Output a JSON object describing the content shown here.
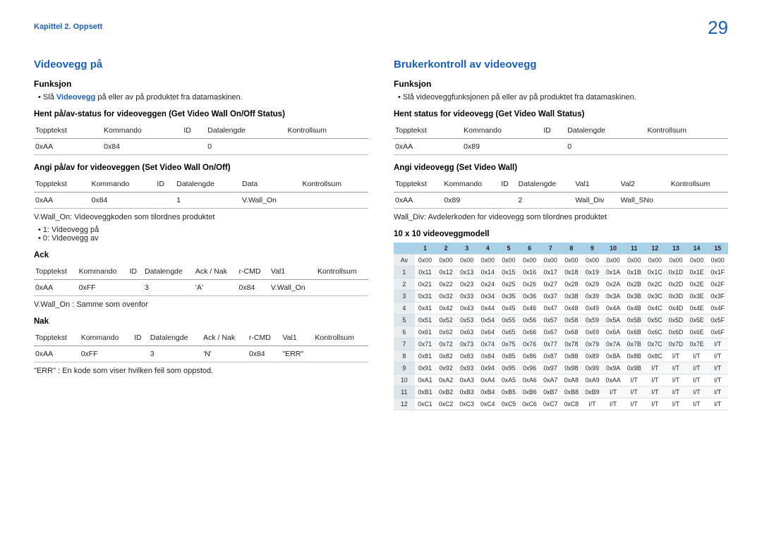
{
  "page": {
    "chapter": "Kapittel 2. Oppsett",
    "number": "29"
  },
  "left": {
    "title": "Videovegg på",
    "funksjon_label": "Funksjon",
    "funksjon_pre": "Slå ",
    "funksjon_accent": "Videovegg",
    "funksjon_post": " på eller av på produktet fra datamaskinen.",
    "get_heading": "Hent på/av-status for videoveggen (Get Video Wall On/Off Status)",
    "set_heading": "Angi på/av for videoveggen (Set Video Wall On/Off)",
    "cols5": {
      "c1": "Topptekst",
      "c2": "Kommando",
      "c3": "ID",
      "c4": "Datalengde",
      "c5": "Kontrollsum"
    },
    "get_row": {
      "c1": "0xAA",
      "c2": "0x84",
      "c3": "",
      "c4": "0",
      "c5": ""
    },
    "set_cols": {
      "c1": "Topptekst",
      "c2": "Kommando",
      "c3": "ID",
      "c4": "Datalengde",
      "c5": "Data",
      "c6": "Kontrollsum"
    },
    "set_row": {
      "c1": "0xAA",
      "c2": "0x84",
      "c3": "",
      "c4": "1",
      "c5": "V.Wall_On",
      "c6": ""
    },
    "explain": "V.Wall_On: Videoveggkoden som tilordnes produktet",
    "opt1": "1: Videovegg på",
    "opt0": "0: Videovegg av",
    "ack_label": "Ack",
    "nak_label": "Nak",
    "ack_cols": {
      "c1": "Topptekst",
      "c2": "Kommando",
      "c3": "ID",
      "c4": "Datalengde",
      "c5": "Ack / Nak",
      "c6": "r-CMD",
      "c7": "Val1",
      "c8": "Kontrollsum"
    },
    "ack_row": {
      "c1": "0xAA",
      "c2": "0xFF",
      "c3": "",
      "c4": "3",
      "c5": "'A'",
      "c6": "0x84",
      "c7": "V.Wall_On",
      "c8": ""
    },
    "ack_note": "V.Wall_On : Samme som ovenfor",
    "nak_row": {
      "c1": "0xAA",
      "c2": "0xFF",
      "c3": "",
      "c4": "3",
      "c5": "'N'",
      "c6": "0x84",
      "c7": "\"ERR\"",
      "c8": ""
    },
    "err_note": "\"ERR\" : En kode som viser hvilken feil som oppstod."
  },
  "right": {
    "title": "Brukerkontroll av videovegg",
    "funksjon_label": "Funksjon",
    "funksjon_bullet": "Slå videoveggfunksjonen på eller av på produktet fra datamaskinen.",
    "get_heading": "Hent status for videovegg (Get Video Wall Status)",
    "set_heading": "Angi videovegg (Set Video Wall)",
    "cols5": {
      "c1": "Topptekst",
      "c2": "Kommando",
      "c3": "ID",
      "c4": "Datalengde",
      "c5": "Kontrollsum"
    },
    "get_row": {
      "c1": "0xAA",
      "c2": "0x89",
      "c3": "",
      "c4": "0",
      "c5": ""
    },
    "set_cols": {
      "c1": "Topptekst",
      "c2": "Kommando",
      "c3": "ID",
      "c4": "Datalengde",
      "c5": "Val1",
      "c6": "Val2",
      "c7": "Kontrollsum"
    },
    "set_row": {
      "c1": "0xAA",
      "c2": "0x89",
      "c3": "",
      "c4": "2",
      "c5": "Wall_Div",
      "c6": "Wall_SNo",
      "c7": ""
    },
    "explain": "Wall_Div: Avdelerkoden for videovegg som tilordnes produktet",
    "matrix_heading": "10 x 10 videoveggmodell"
  },
  "chart_data": {
    "type": "table",
    "title": "10 x 10 videoveggmodell",
    "column_headers": [
      "1",
      "2",
      "3",
      "4",
      "5",
      "6",
      "7",
      "8",
      "9",
      "10",
      "11",
      "12",
      "13",
      "14",
      "15"
    ],
    "row_headers": [
      "Av",
      "1",
      "2",
      "3",
      "4",
      "5",
      "6",
      "7",
      "8",
      "9",
      "10",
      "11",
      "12"
    ],
    "rows": [
      [
        "0x00",
        "0x00",
        "0x00",
        "0x00",
        "0x00",
        "0x00",
        "0x00",
        "0x00",
        "0x00",
        "0x00",
        "0x00",
        "0x00",
        "0x00",
        "0x00",
        "0x00"
      ],
      [
        "0x11",
        "0x12",
        "0x13",
        "0x14",
        "0x15",
        "0x16",
        "0x17",
        "0x18",
        "0x19",
        "0x1A",
        "0x1B",
        "0x1C",
        "0x1D",
        "0x1E",
        "0x1F"
      ],
      [
        "0x21",
        "0x22",
        "0x23",
        "0x24",
        "0x25",
        "0x26",
        "0x27",
        "0x28",
        "0x29",
        "0x2A",
        "0x2B",
        "0x2C",
        "0x2D",
        "0x2E",
        "0x2F"
      ],
      [
        "0x31",
        "0x32",
        "0x33",
        "0x34",
        "0x35",
        "0x36",
        "0x37",
        "0x38",
        "0x39",
        "0x3A",
        "0x3B",
        "0x3C",
        "0x3D",
        "0x3E",
        "0x3F"
      ],
      [
        "0x41",
        "0x42",
        "0x43",
        "0x44",
        "0x45",
        "0x46",
        "0x47",
        "0x48",
        "0x49",
        "0x4A",
        "0x4B",
        "0x4C",
        "0x4D",
        "0x4E",
        "0x4F"
      ],
      [
        "0x51",
        "0x52",
        "0x53",
        "0x54",
        "0x55",
        "0x56",
        "0x57",
        "0x58",
        "0x59",
        "0x5A",
        "0x5B",
        "0x5C",
        "0x5D",
        "0x5E",
        "0x5F"
      ],
      [
        "0x61",
        "0x62",
        "0x63",
        "0x64",
        "0x65",
        "0x66",
        "0x67",
        "0x68",
        "0x69",
        "0x6A",
        "0x6B",
        "0x6C",
        "0x6D",
        "0x6E",
        "0x6F"
      ],
      [
        "0x71",
        "0x72",
        "0x73",
        "0x74",
        "0x75",
        "0x76",
        "0x77",
        "0x78",
        "0x79",
        "0x7A",
        "0x7B",
        "0x7C",
        "0x7D",
        "0x7E",
        "I/T"
      ],
      [
        "0x81",
        "0x82",
        "0x83",
        "0x84",
        "0x85",
        "0x86",
        "0x87",
        "0x88",
        "0x89",
        "0x8A",
        "0x8B",
        "0x8C",
        "I/T",
        "I/T",
        "I/T"
      ],
      [
        "0x91",
        "0x92",
        "0x93",
        "0x94",
        "0x95",
        "0x96",
        "0x97",
        "0x98",
        "0x99",
        "0x9A",
        "0x9B",
        "I/T",
        "I/T",
        "I/T",
        "I/T"
      ],
      [
        "0xA1",
        "0xA2",
        "0xA3",
        "0xA4",
        "0xA5",
        "0xA6",
        "0xA7",
        "0xA8",
        "0xA9",
        "0xAA",
        "I/T",
        "I/T",
        "I/T",
        "I/T",
        "I/T"
      ],
      [
        "0xB1",
        "0xB2",
        "0xB3",
        "0xB4",
        "0xB5",
        "0xB6",
        "0xB7",
        "0xB8",
        "0xB9",
        "I/T",
        "I/T",
        "I/T",
        "I/T",
        "I/T",
        "I/T"
      ],
      [
        "0xC1",
        "0xC2",
        "0xC3",
        "0xC4",
        "0xC5",
        "0xC6",
        "0xC7",
        "0xC8",
        "I/T",
        "I/T",
        "I/T",
        "I/T",
        "I/T",
        "I/T",
        "I/T"
      ]
    ]
  }
}
